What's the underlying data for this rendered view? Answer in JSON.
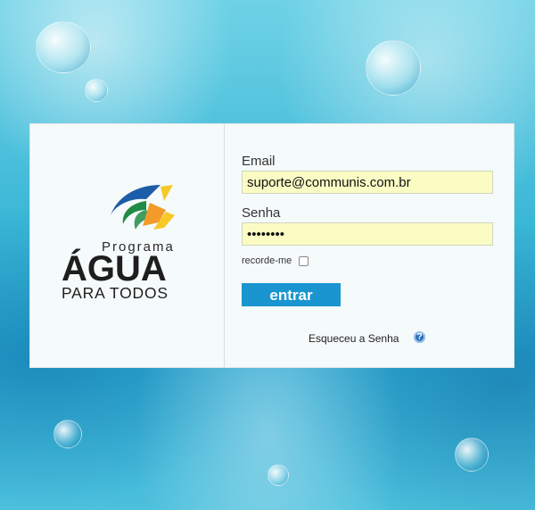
{
  "logo": {
    "line1": "Programa",
    "line2": "ÁGUA",
    "line3": "PARA TODOS",
    "colors": {
      "blue": "#1b5da8",
      "green": "#1f8c45",
      "orange": "#f29b2b",
      "yellow": "#f7c927"
    }
  },
  "form": {
    "email_label": "Email",
    "email_value": "suporte@communis.com.br",
    "password_label": "Senha",
    "password_value": "12345678",
    "remember_label": "recorde-me",
    "submit_label": "entrar",
    "forgot_label": "Esqueceu a Senha",
    "help_icon": "?"
  },
  "colors": {
    "button": "#1a95cf",
    "input_bg": "#fbfbc4",
    "panel_bg": "#f5fafb"
  }
}
